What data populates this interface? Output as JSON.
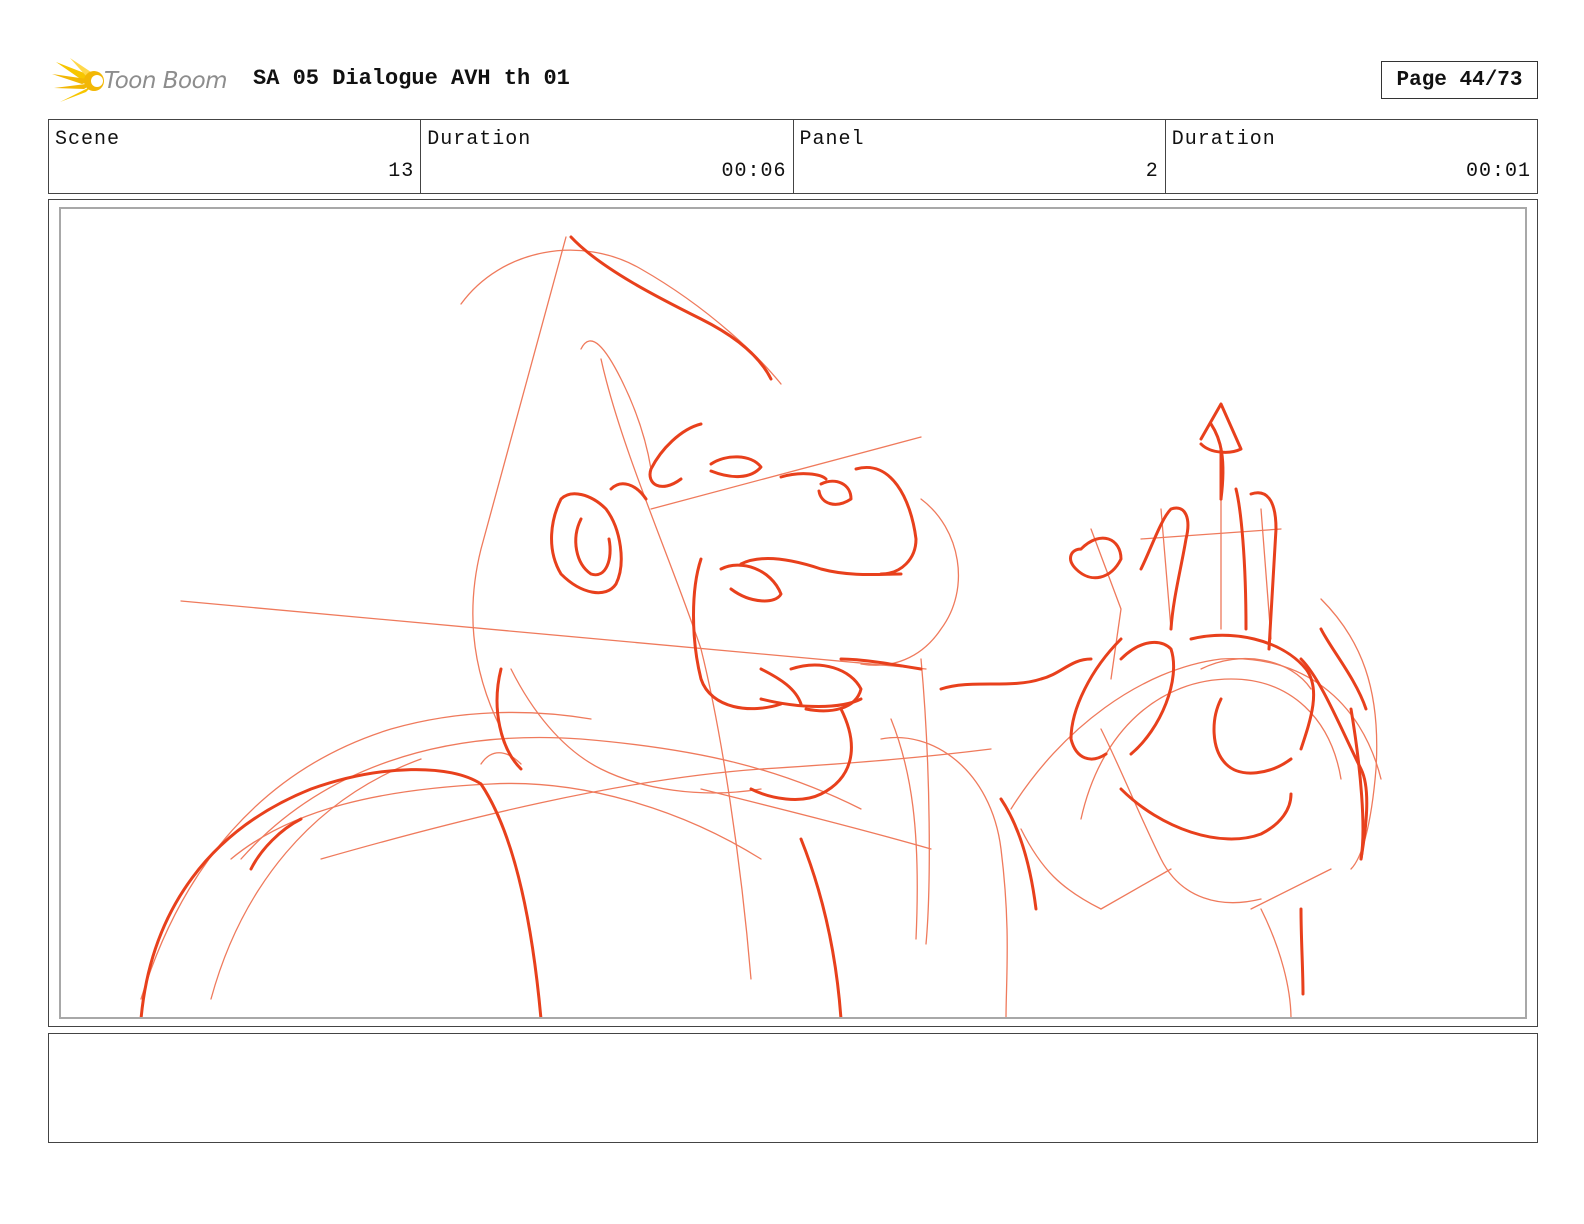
{
  "header": {
    "logo_text": "Toon Boom",
    "title": "SA 05 Dialogue AVH th 01",
    "page": "Page 44/73"
  },
  "info": [
    {
      "label": "Scene",
      "value": "13"
    },
    {
      "label": "Duration",
      "value": "00:06"
    },
    {
      "label": "Panel",
      "value": "2"
    },
    {
      "label": "Duration",
      "value": "00:01"
    }
  ],
  "colors": {
    "sketch": "#e8401c",
    "sketch_light": "#ef7a5c",
    "logo_gold": "#f2b705"
  },
  "notes": ""
}
